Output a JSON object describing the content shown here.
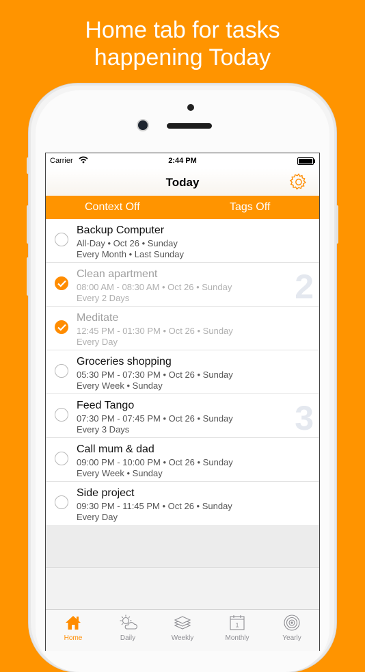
{
  "headline": {
    "line1": "Home tab for tasks",
    "line2": "happening Today"
  },
  "status": {
    "carrier": "Carrier",
    "time": "2:44 PM"
  },
  "nav": {
    "title": "Today"
  },
  "filters": {
    "context": "Context Off",
    "tags": "Tags Off"
  },
  "tasks": [
    {
      "title": "Backup Computer",
      "line1": "All-Day • Oct 26 • Sunday",
      "line2": "Every Month • Last Sunday",
      "done": false
    },
    {
      "title": "Clean apartment",
      "line1": "08:00 AM - 08:30 AM • Oct 26 • Sunday",
      "line2": "Every 2 Days",
      "done": true
    },
    {
      "title": "Meditate",
      "line1": "12:45 PM - 01:30 PM • Oct 26 • Sunday",
      "line2": "Every Day",
      "done": true
    },
    {
      "title": "Groceries shopping",
      "line1": "05:30 PM - 07:30 PM • Oct 26 • Sunday",
      "line2": "Every Week • Sunday",
      "done": false
    },
    {
      "title": "Feed Tango",
      "line1": "07:30 PM - 07:45 PM • Oct 26 • Sunday",
      "line2": "Every 3 Days",
      "done": false
    },
    {
      "title": "Call mum & dad",
      "line1": "09:00 PM - 10:00 PM • Oct 26 • Sunday",
      "line2": "Every Week • Sunday",
      "done": false
    },
    {
      "title": "Side project",
      "line1": "09:30 PM - 11:45 PM • Oct 26 • Sunday",
      "line2": "Every Day",
      "done": false
    }
  ],
  "watermarks": {
    "first": "2",
    "second": "3"
  },
  "tabs": {
    "home": "Home",
    "daily": "Daily",
    "weekly": "Weekly",
    "monthly": "Monthly",
    "monthly_day": "1",
    "yearly": "Yearly"
  },
  "colors": {
    "accent": "#FF9400",
    "check": "#FF8C00"
  },
  "icons": [
    "wifi-icon",
    "battery-icon",
    "gear-icon",
    "checkmark-icon",
    "home-icon",
    "sun-cloud-icon",
    "layers-icon",
    "calendar-icon",
    "target-icon"
  ]
}
